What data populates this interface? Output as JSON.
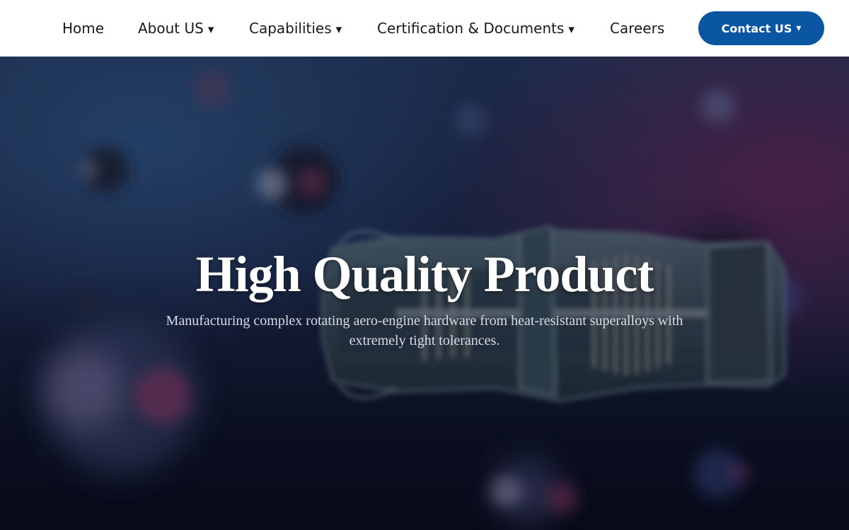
{
  "nav": {
    "items": [
      {
        "label": "Home",
        "caret": ""
      },
      {
        "label": "About US",
        "caret": "▾"
      },
      {
        "label": "Capabilities",
        "caret": "▾"
      },
      {
        "label": "Certification & Documents",
        "caret": "▾"
      },
      {
        "label": "Careers",
        "caret": ""
      }
    ],
    "contact": {
      "label": "Contact US",
      "caret": "▾"
    }
  },
  "hero": {
    "title": "High Quality Product",
    "subtitle": "Manufacturing complex rotating aero-engine hardware from heat-resistant superalloys with extremely tight tolerances.",
    "image_icon": "jet-engine-cutaway-illustration"
  },
  "colors": {
    "nav_background": "#ffffff",
    "contact_button": "#0a56a3",
    "hero_title": "#ffffff",
    "hero_subtitle": "#d8dce6"
  }
}
